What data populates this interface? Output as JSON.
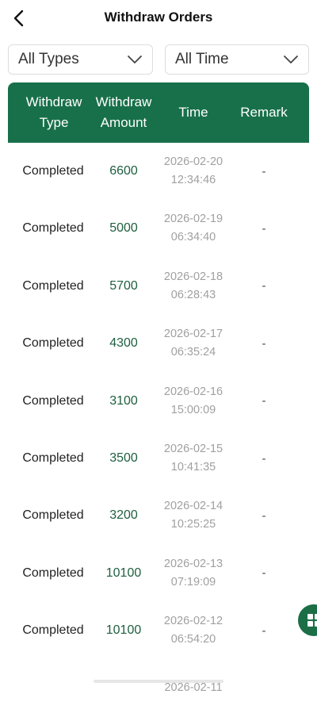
{
  "header": {
    "title": "Withdraw Orders"
  },
  "filters": {
    "type": "All Types",
    "time": "All Time"
  },
  "columns": {
    "type_line1": "Withdraw",
    "type_line2": "Type",
    "amount_line1": "Withdraw",
    "amount_line2": "Amount",
    "time": "Time",
    "remark": "Remark"
  },
  "rows": [
    {
      "type": "Completed",
      "amount": "6600",
      "date": "2026-02-20",
      "clock": "12:34:46",
      "remark": "-"
    },
    {
      "type": "Completed",
      "amount": "5000",
      "date": "2026-02-19",
      "clock": "06:34:40",
      "remark": "-"
    },
    {
      "type": "Completed",
      "amount": "5700",
      "date": "2026-02-18",
      "clock": "06:28:43",
      "remark": "-"
    },
    {
      "type": "Completed",
      "amount": "4300",
      "date": "2026-02-17",
      "clock": "06:35:24",
      "remark": "-"
    },
    {
      "type": "Completed",
      "amount": "3100",
      "date": "2026-02-16",
      "clock": "15:00:09",
      "remark": "-"
    },
    {
      "type": "Completed",
      "amount": "3500",
      "date": "2026-02-15",
      "clock": "10:41:35",
      "remark": "-"
    },
    {
      "type": "Completed",
      "amount": "3200",
      "date": "2026-02-14",
      "clock": "10:25:25",
      "remark": "-"
    },
    {
      "type": "Completed",
      "amount": "10100",
      "date": "2026-02-13",
      "clock": "07:19:09",
      "remark": "-"
    },
    {
      "type": "Completed",
      "amount": "10100",
      "date": "2026-02-12",
      "clock": "06:54:20",
      "remark": "-"
    },
    {
      "type": "",
      "amount": "",
      "date": "2026-02-11",
      "clock": "",
      "remark": ""
    }
  ],
  "colors": {
    "accent": "#18704a",
    "amount": "#1e5f3f",
    "time": "#a0a0a0"
  },
  "icons": {
    "back": "chevron-left-icon",
    "dropdown": "chevron-down-icon",
    "fab": "grid-icon"
  }
}
